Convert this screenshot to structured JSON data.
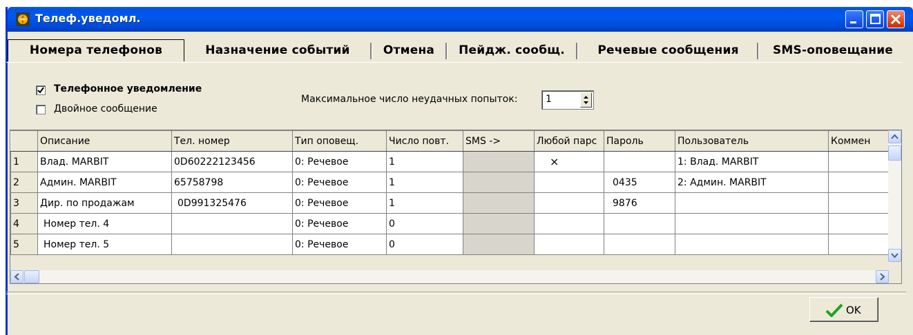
{
  "window": {
    "title": "Телеф.уведомл."
  },
  "tabs": [
    {
      "label": "Номера телефонов"
    },
    {
      "label": "Назначение событий"
    },
    {
      "label": "Отмена"
    },
    {
      "label": "Пейдж. сообщ."
    },
    {
      "label": "Речевые сообщения"
    },
    {
      "label": "SMS-оповещание"
    }
  ],
  "options": {
    "phone_notification": {
      "label": "Телефонное уведомление",
      "checked": true
    },
    "double_message": {
      "label": "Двойное сообщение",
      "checked": false
    },
    "max_failed_attempts": {
      "label": "Максимальное число неудачных попыток:",
      "value": "1"
    }
  },
  "table": {
    "columns": [
      "",
      "Описание",
      "Тел. номер",
      "Тип оповещ.",
      "Число повт.",
      "SMS ->",
      "Любой парс",
      "Пароль",
      "Пользователь",
      "Коммен"
    ],
    "rows": [
      [
        "1",
        "Влад. MARBIT",
        "0D60222123456",
        "0: Речевое",
        "1",
        "",
        "×",
        "",
        "1: Влад. MARBIT",
        ""
      ],
      [
        "2",
        "Админ. MARBIT",
        "65758798",
        "0: Речевое",
        "1",
        "",
        "",
        "0435",
        "2: Админ. MARBIT",
        ""
      ],
      [
        "3",
        "Дир. по продажам",
        "0D991325476",
        "0: Речевое",
        "1",
        "",
        "",
        "9876",
        "",
        ""
      ],
      [
        "4",
        "Номер тел. 4",
        "",
        "0: Речевое",
        "0",
        "",
        "",
        "",
        "",
        ""
      ],
      [
        "5",
        "Номер тел. 5",
        "",
        "0: Речевое",
        "0",
        "",
        "",
        "",
        "",
        ""
      ]
    ]
  },
  "footer": {
    "ok_label": "OK"
  },
  "colors": {
    "titlebar": "#0054e3",
    "window_bg": "#ece9d8",
    "check_green": "#1fa31f"
  }
}
